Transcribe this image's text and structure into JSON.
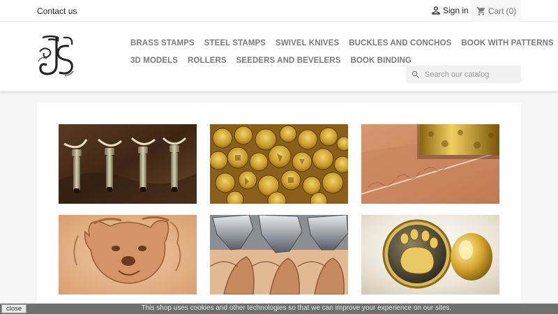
{
  "topbar": {
    "contact_label": "Contact us",
    "signin_label": "Sign in",
    "cart_label": "Cart",
    "cart_count": "(0)"
  },
  "header": {
    "menu_row1": [
      "BRASS STAMPS",
      "STEEL STAMPS",
      "SWIVEL KNIVES",
      "BUCKLES AND CONCHOS",
      "BOOK WITH PATTERNS"
    ],
    "menu_row2": [
      "3D MODELS",
      "ROLLERS",
      "SEEDERS AND BEVELERS",
      "BOOK BINDING"
    ],
    "search_placeholder": "Search our catalog"
  },
  "cookie": {
    "text": "This shop uses cookies and other technologies so that we can improve your experience on our sites.",
    "close_label": "close"
  },
  "icons": {
    "user": "user-icon",
    "cart": "shopping-cart-icon",
    "search": "search-icon"
  },
  "colors": {
    "menu_text": "#7a7a7a",
    "page_bg": "#f6f6f6",
    "cookie_bg": "#6f6f6f"
  }
}
